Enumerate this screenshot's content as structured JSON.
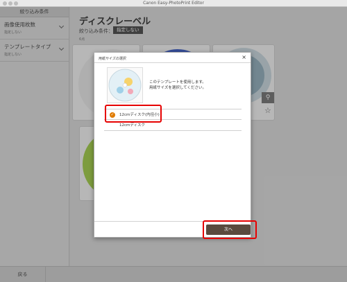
{
  "window": {
    "title": "Canon Easy-PhotoPrint Editor"
  },
  "sidebar": {
    "header": "絞り込み条件",
    "filters": [
      {
        "label": "画像使用枚数",
        "value": "指定しない"
      },
      {
        "label": "テンプレートタイプ",
        "value": "指定しない"
      }
    ]
  },
  "main": {
    "title": "ディスクレーベル",
    "filter_label": "絞り込み条件：",
    "filter_value": "指定しない",
    "count": "6点"
  },
  "bottom": {
    "back_label": "戻る"
  },
  "dialog": {
    "title": "用紙サイズの選択",
    "close": "×",
    "message_line1": "このテンプレートを使用します。",
    "message_line2": "用紙サイズを選択してください。",
    "options": [
      {
        "label": "12cmディスク(内径小)",
        "selected": true
      },
      {
        "label": "12cmディスク",
        "selected": false
      }
    ],
    "next_label": "次へ"
  },
  "colors": {
    "accent": "#e07b00",
    "highlight": "#e60000",
    "next_button": "#5a4a3e"
  }
}
